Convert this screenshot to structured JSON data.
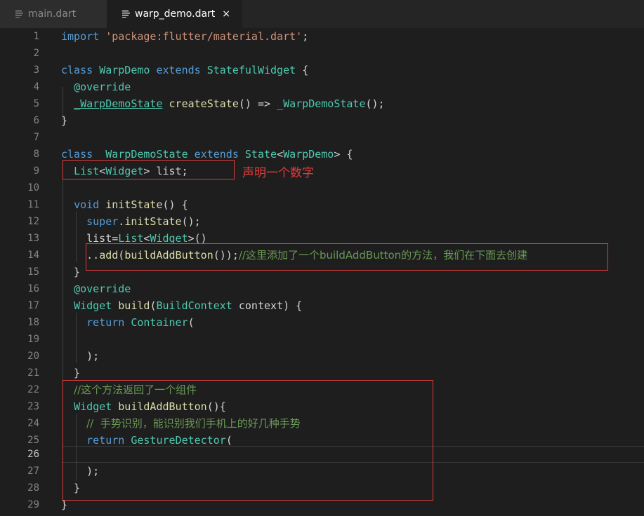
{
  "tabs": [
    {
      "label": "main.dart",
      "icon": "lines-icon",
      "active": false
    },
    {
      "label": "warp_demo.dart",
      "icon": "lines-icon",
      "active": true,
      "close": "×"
    }
  ],
  "line_numbers": [
    "1",
    "2",
    "3",
    "4",
    "5",
    "6",
    "7",
    "8",
    "9",
    "10",
    "11",
    "12",
    "13",
    "14",
    "15",
    "16",
    "17",
    "18",
    "19",
    "20",
    "21",
    "22",
    "23",
    "24",
    "25",
    "26",
    "27",
    "28",
    "29"
  ],
  "current_line": "26",
  "code": {
    "l1": {
      "a": "import",
      "b": " ",
      "c": "'package:flutter/material.dart'",
      "d": ";"
    },
    "l3": {
      "a": "class",
      "b": " ",
      "c": "WarpDemo",
      "d": " ",
      "e": "extends",
      "f": " ",
      "g": "StatefulWidget",
      "h": " {"
    },
    "l4": {
      "a": "  ",
      "b": "@override"
    },
    "l5": {
      "a": "  ",
      "b": "_WarpDemoState",
      "c": " ",
      "d": "createState",
      "e": "() => ",
      "f": "_WarpDemoState",
      "g": "();"
    },
    "l6": {
      "a": "}"
    },
    "l8": {
      "a": "class",
      "b": "  ",
      "c": "WarpDemoState",
      "d": " ",
      "e": "extends",
      "f": " ",
      "g": "State",
      "h": "<",
      "i": "WarpDemo",
      "j": "> {"
    },
    "l9": {
      "a": "  ",
      "b": "List",
      "c": "<",
      "d": "Widget",
      "e": "> list;"
    },
    "l11": {
      "a": "  ",
      "b": "void",
      "c": " ",
      "d": "initState",
      "e": "() {"
    },
    "l12": {
      "a": "    ",
      "b": "super",
      "c": ".",
      "d": "initState",
      "e": "();"
    },
    "l13": {
      "a": "    list=",
      "b": "List",
      "c": "<",
      "d": "Widget",
      "e": ">()"
    },
    "l14": {
      "a": "    ..",
      "b": "add",
      "c": "(",
      "d": "buildAddButton",
      "e": "());",
      "f": "//这里添加了一个buildAddButton的方法，我们在下面去创建"
    },
    "l15": {
      "a": "  }"
    },
    "l16": {
      "a": "  ",
      "b": "@override"
    },
    "l17": {
      "a": "  ",
      "b": "Widget",
      "c": " ",
      "d": "build",
      "e": "(",
      "f": "BuildContext",
      "g": " context) {"
    },
    "l18": {
      "a": "    ",
      "b": "return",
      "c": " ",
      "d": "Container",
      "e": "("
    },
    "l20": {
      "a": "    );"
    },
    "l21": {
      "a": "  }"
    },
    "l22": {
      "a": "  ",
      "b": "//这个方法返回了一个组件"
    },
    "l23": {
      "a": "  ",
      "b": "Widget",
      "c": " ",
      "d": "buildAddButton",
      "e": "(){"
    },
    "l24": {
      "a": "    ",
      "b": "//  手势识别，能识别我们手机上的好几种手势"
    },
    "l25": {
      "a": "    ",
      "b": "return",
      "c": " ",
      "d": "GestureDetector",
      "e": "("
    },
    "l27": {
      "a": "    );"
    },
    "l28": {
      "a": "  }"
    },
    "l29": {
      "a": "}"
    }
  },
  "annotations": {
    "list_label": "声明一个数字"
  },
  "colors": {
    "annotation": "#e03c3c",
    "keyword": "#569cd6",
    "type": "#4ec9b0",
    "function": "#dcdcaa",
    "string": "#ce9178",
    "comment": "#6a9955"
  }
}
